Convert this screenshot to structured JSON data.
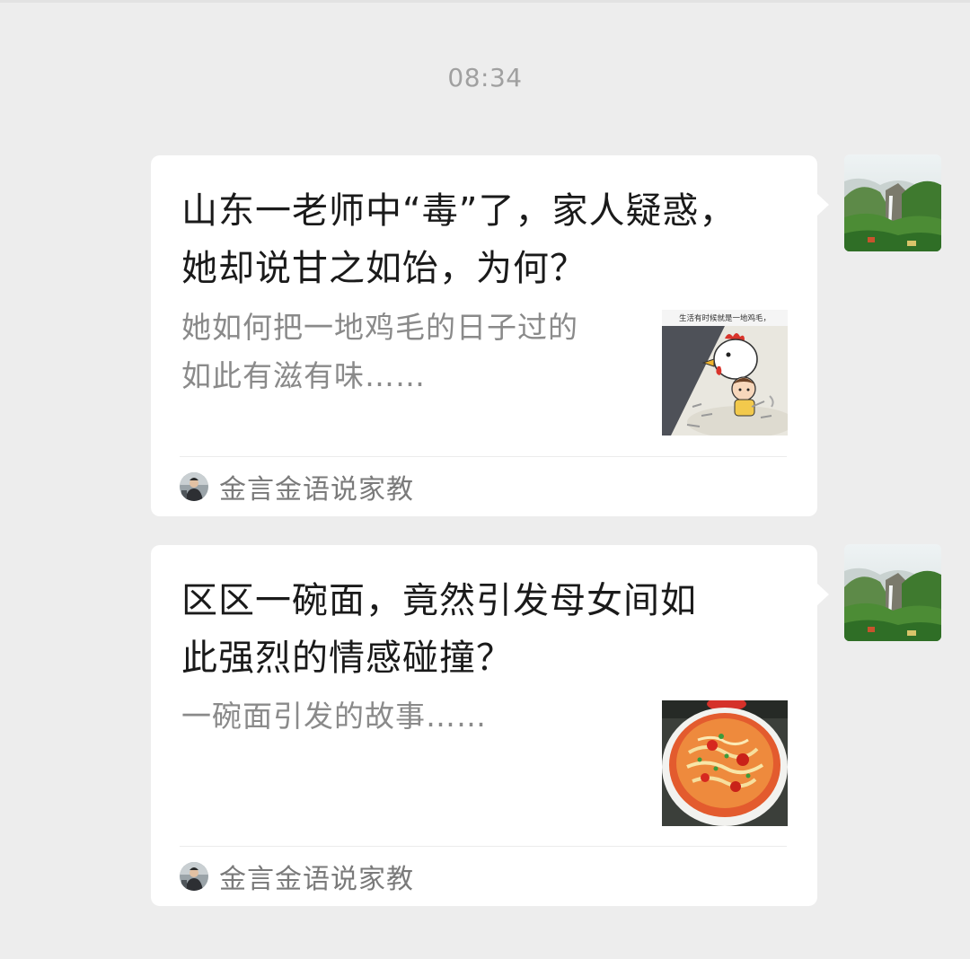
{
  "timestamp": "08:34",
  "messages": [
    {
      "title": "山东一老师中“毒”了，家人疑惑，她却说甘之如饴，为何？",
      "title_line1": "山东一老师中“毒”了，家人疑惑，",
      "title_line2": "她却说甘之如饴，为何？",
      "desc_line1": "她如何把一地鸡毛的日子过的",
      "desc_line2": "如此有滋有味……",
      "thumb_caption": "生活有时候就是一地鸡毛，",
      "thumb_icon": "chicken-cartoon-image",
      "source": "金言金语说家教",
      "sender_avatar": "mountain-waterfall-image"
    },
    {
      "title": "区区一碗面，竟然引发母女间如此强烈的情感碰撞？",
      "title_line1": "区区一碗面，竟然引发母女间如",
      "title_line2": "此强烈的情感碰撞？",
      "desc_line1": "一碗面引发的故事……",
      "desc_line2": "",
      "thumb_icon": "tomato-egg-noodle-bowl-image",
      "source": "金言金语说家教",
      "sender_avatar": "mountain-waterfall-image"
    }
  ],
  "colors": {
    "background": "#ededed",
    "card": "#ffffff",
    "title_text": "#1a1a1a",
    "desc_text": "#8a8a8a",
    "timestamp_text": "#a0a0a0"
  }
}
